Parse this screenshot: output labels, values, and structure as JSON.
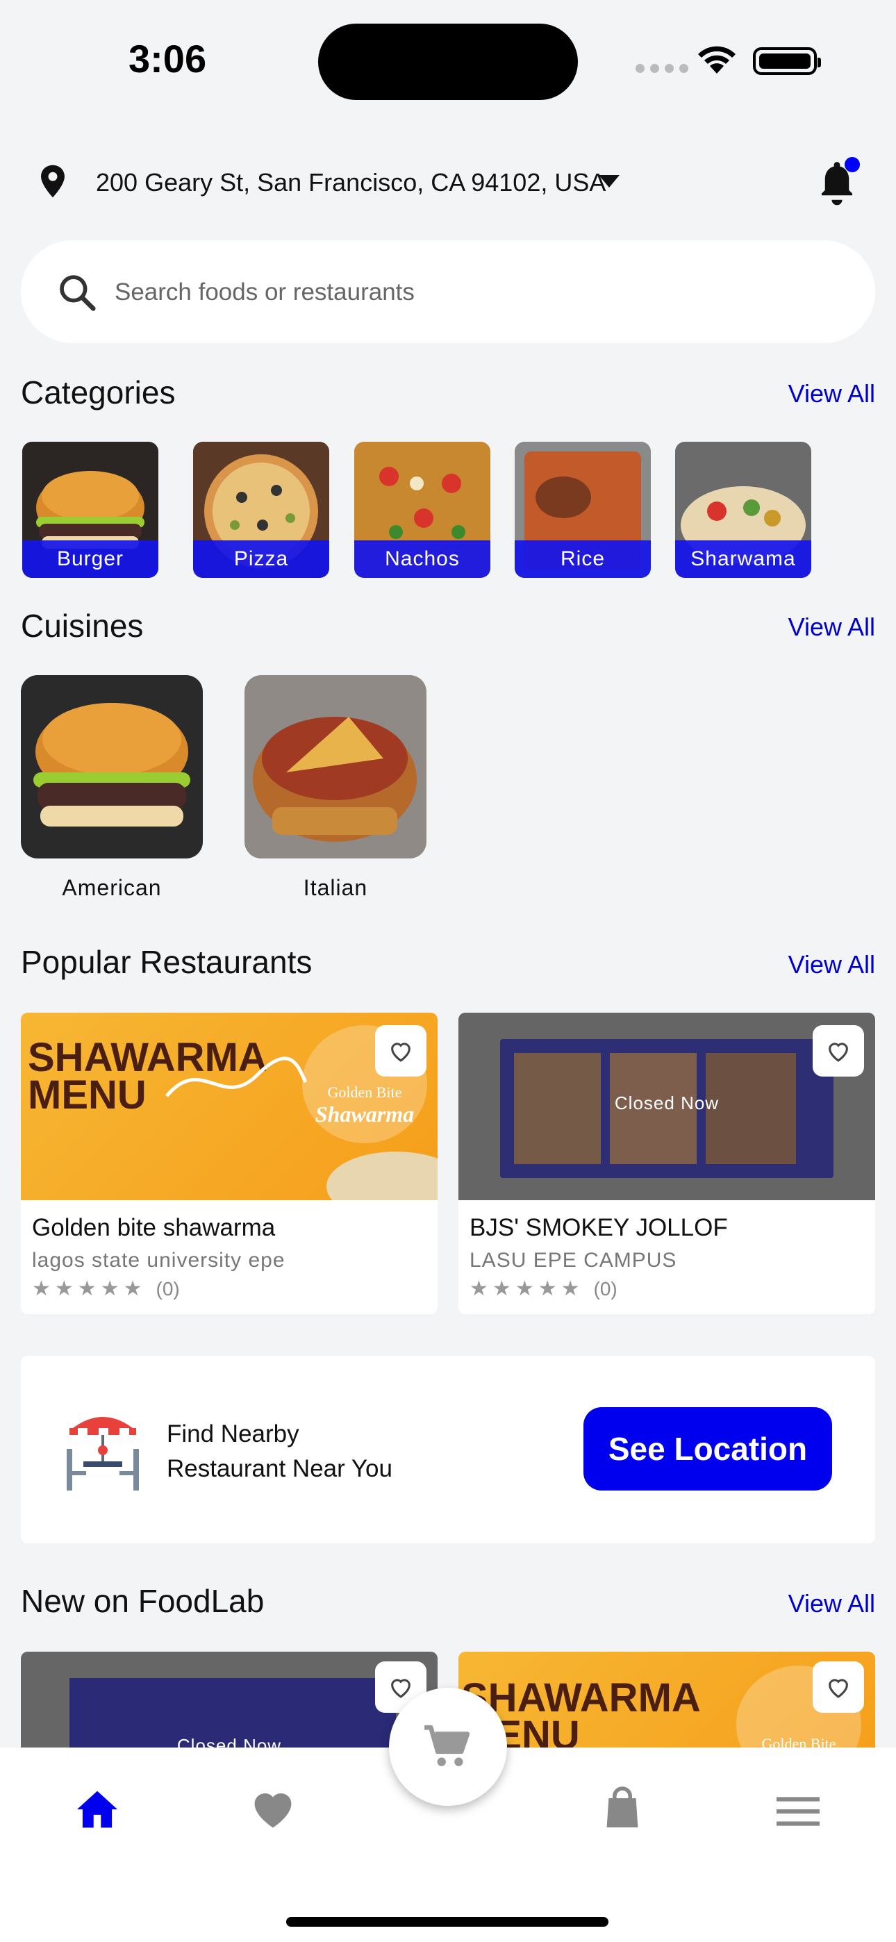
{
  "status_bar": {
    "time": "3:06"
  },
  "location": {
    "address": "200 Geary St, San Francisco, CA 94102, USA"
  },
  "search": {
    "placeholder": "Search foods or restaurants"
  },
  "categories": {
    "title": "Categories",
    "view_all": "View All",
    "items": [
      {
        "label": "Burger"
      },
      {
        "label": "Pizza"
      },
      {
        "label": "Nachos"
      },
      {
        "label": "Rice"
      },
      {
        "label": "Sharwama"
      }
    ]
  },
  "cuisines": {
    "title": "Cuisines",
    "view_all": "View All",
    "items": [
      {
        "label": "American"
      },
      {
        "label": "Italian"
      }
    ]
  },
  "popular": {
    "title": "Popular Restaurants",
    "view_all": "View All",
    "items": [
      {
        "name": "Golden bite shawarma",
        "address": "lagos state university epe",
        "rating_count": "(0)",
        "banner_text_1": "SHAWARMA",
        "banner_text_2": "MENU",
        "logo_text_1": "Golden Bite",
        "logo_text_2": "Shawarma"
      },
      {
        "name": "BJS' SMOKEY JOLLOF",
        "address": "LASU EPE CAMPUS",
        "rating_count": "(0)",
        "status": "Closed Now"
      }
    ]
  },
  "promo": {
    "line1": "Find Nearby",
    "line2": "Restaurant Near You",
    "button": "See Location"
  },
  "new_on": {
    "title": "New on FoodLab",
    "view_all": "View All",
    "items": [
      {
        "status": "Closed Now"
      },
      {
        "banner_text_1": "SHAWARMA",
        "banner_text_2": "MENU",
        "logo_text_1": "Golden Bite"
      }
    ]
  },
  "nav": {
    "items": [
      "home-icon",
      "heart-icon",
      "cart-icon",
      "bag-icon",
      "menu-icon"
    ],
    "active": "home-icon"
  },
  "colors": {
    "accent": "#0000ff",
    "link": "#0000cc",
    "banner_orange": "#f5a623"
  }
}
